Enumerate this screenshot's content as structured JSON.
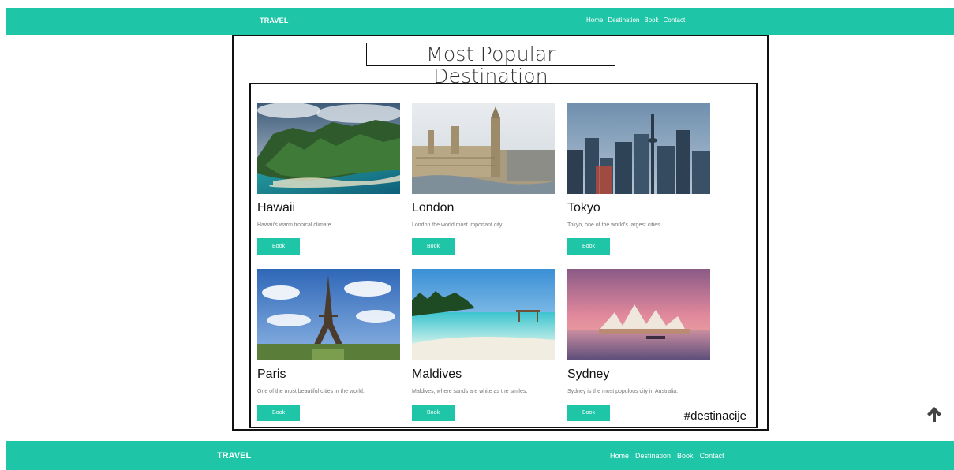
{
  "header": {
    "brand": "TRAVEL",
    "nav": [
      "Home",
      "Destination",
      "Book",
      "Contact"
    ]
  },
  "main": {
    "title": "Most Popular Destination",
    "hashtag": "#destinacije",
    "cards": [
      {
        "name": "Hawaii",
        "desc": "Hawaii's warm tropical climate.",
        "button": "Book",
        "image": "island-cliffs-coast"
      },
      {
        "name": "London",
        "desc": "London the world most important city.",
        "button": "Book",
        "image": "westminster-aerial"
      },
      {
        "name": "Tokyo",
        "desc": "Tokyo, one of the world's largest cities.",
        "button": "Book",
        "image": "city-skyline-tower"
      },
      {
        "name": "Paris",
        "desc": "One of the most beautiful cities in the world.",
        "button": "Book",
        "image": "eiffel-tower"
      },
      {
        "name": "Maldives",
        "desc": "Maldives, where sands are white as the smiles.",
        "button": "Book",
        "image": "tropical-beach"
      },
      {
        "name": "Sydney",
        "desc": "Sydney is the most populous city in Australia.",
        "button": "Book",
        "image": "opera-house-sunset"
      }
    ]
  },
  "footer": {
    "brand": "TRAVEL",
    "nav": [
      "Home",
      "Destination",
      "Book",
      "Contact"
    ]
  },
  "colors": {
    "accent": "#1ec5a7",
    "text": "#111111"
  }
}
